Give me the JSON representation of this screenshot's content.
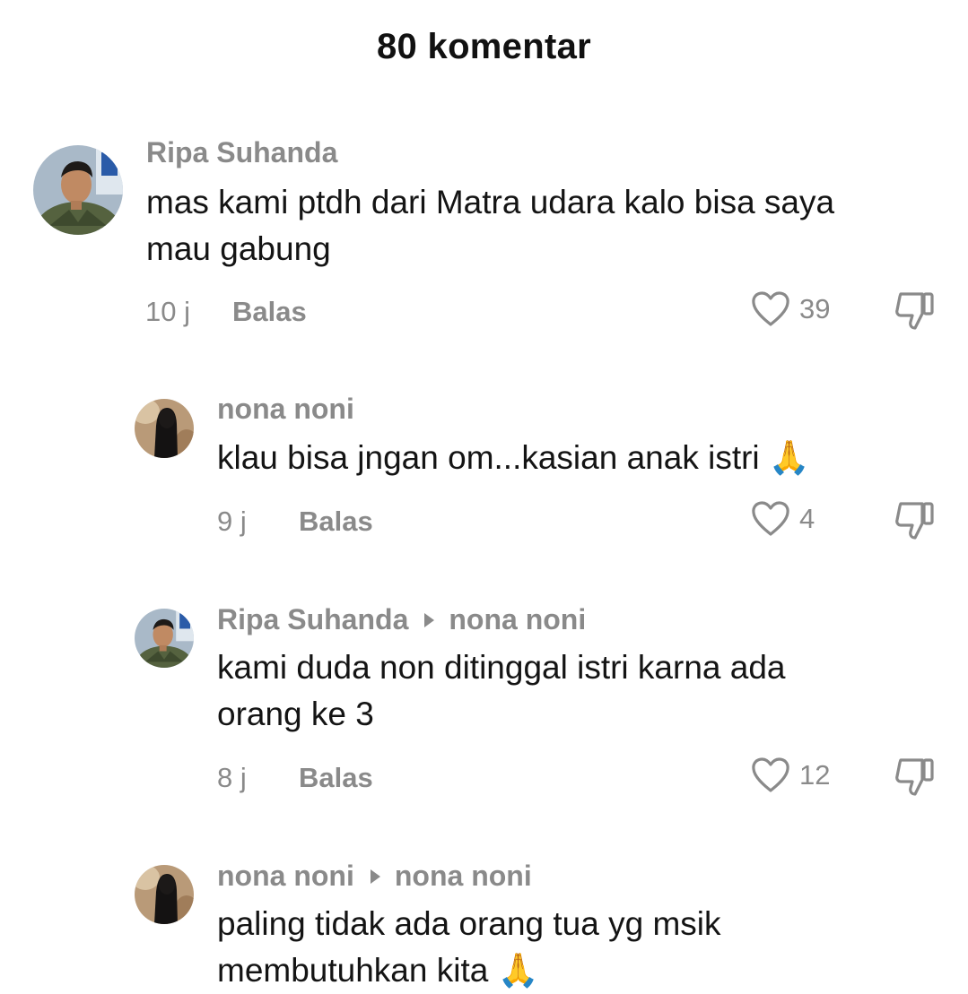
{
  "header": {
    "title": "80 komentar"
  },
  "comments": [
    {
      "user": "Ripa Suhanda",
      "reply_to": "",
      "text_line1": "mas kami ptdh dari Matra udara kalo bisa saya",
      "text_line2": "mau gabung",
      "time": "10 j",
      "reply_label": "Balas",
      "likes": "39",
      "avatar": "soldier-avatar"
    },
    {
      "user": "nona noni",
      "reply_to": "",
      "text_line1": "klau bisa jngan om...kasian anak istri 🙏",
      "text_line2": "",
      "time": "9 j",
      "reply_label": "Balas",
      "likes": "4",
      "avatar": "veiled-woman-avatar"
    },
    {
      "user": "Ripa Suhanda",
      "reply_to": "nona noni",
      "text_line1": "kami duda non ditinggal istri karna ada",
      "text_line2": "orang ke 3",
      "time": "8 j",
      "reply_label": "Balas",
      "likes": "12",
      "avatar": "soldier-avatar"
    },
    {
      "user": "nona noni",
      "reply_to": "nona noni",
      "text_line1": "paling tidak ada orang tua yg msik",
      "text_line2": "membutuhkan kita 🙏",
      "avatar": "veiled-woman-avatar"
    }
  ],
  "colors": {
    "muted": "#8a8a8a",
    "text": "#141414",
    "background": "#ffffff"
  },
  "icons": [
    "heart-icon",
    "dislike-icon",
    "reply-arrow-icon"
  ]
}
